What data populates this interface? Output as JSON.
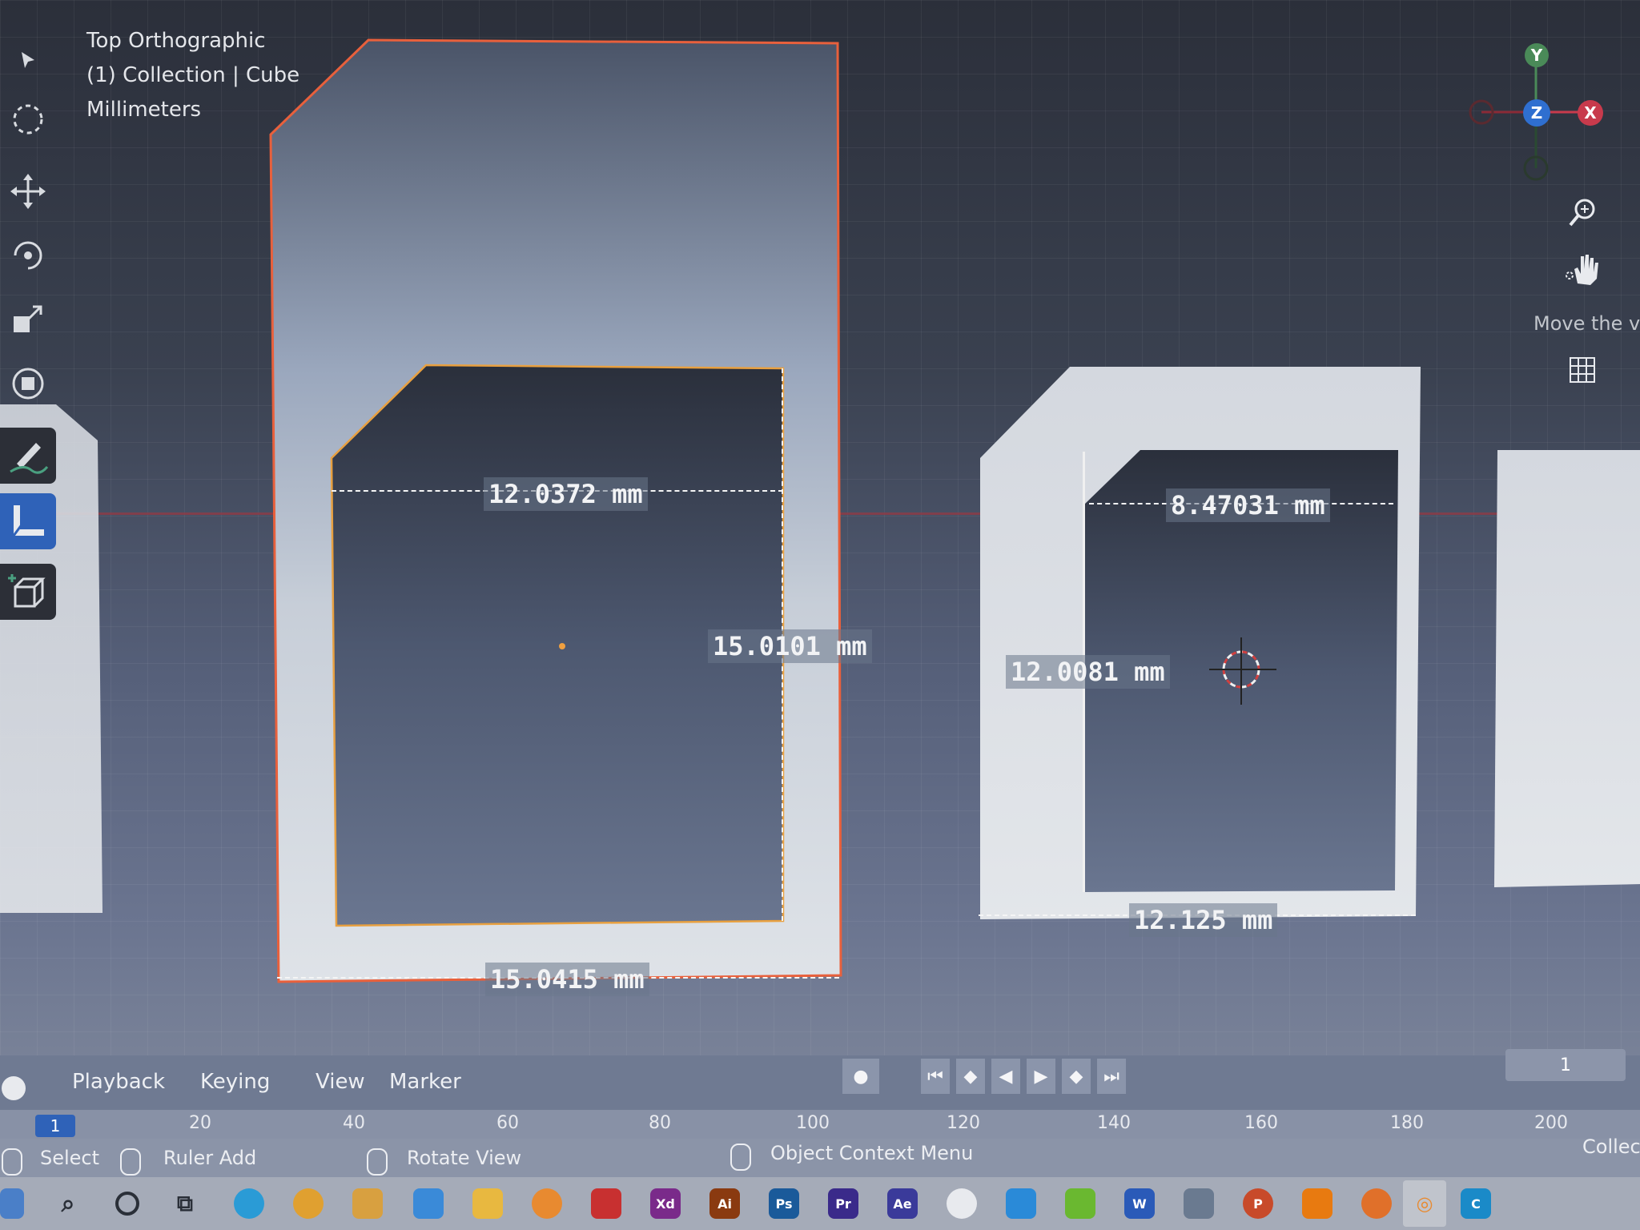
{
  "viewport": {
    "view_name": "Top Orthographic",
    "collection_label": "(1) Collection | Cube",
    "units": "Millimeters",
    "nav_hint": "Move the vi"
  },
  "measurements": {
    "left_inner_width": "12.0372 mm",
    "left_inner_height": "15.0101 mm",
    "left_bottom_width": "15.0415 mm",
    "right_inner_width": "8.47031 mm",
    "right_inner_height": "12.0081 mm",
    "right_bottom_width": "12.125 mm"
  },
  "gizmo": {
    "y": "Y",
    "z": "Z",
    "x": "X",
    "colors": {
      "x": "#c83a4c",
      "y": "#4a8a58",
      "z": "#2f6fd0"
    }
  },
  "timeline": {
    "menus": [
      "Playback",
      "Keying",
      "View",
      "Marker"
    ],
    "current_frame": "1",
    "ruler_ticks": [
      "1",
      "20",
      "40",
      "60",
      "80",
      "100",
      "120",
      "140",
      "160",
      "180",
      "200"
    ]
  },
  "status_bar": {
    "select": "Select",
    "ruler_add": "Ruler Add",
    "rotate_view": "Rotate View",
    "object_context_menu": "Object Context Menu",
    "collection": "Collect"
  },
  "taskbar": {
    "apps": [
      "Xd",
      "Ai",
      "Ps",
      "Pr",
      "Ae",
      "W",
      "P",
      "C"
    ]
  },
  "colors": {
    "selection_outline": "#e8603c",
    "active_tool": "#2f62b8",
    "axis_line": "#8f3b46"
  }
}
